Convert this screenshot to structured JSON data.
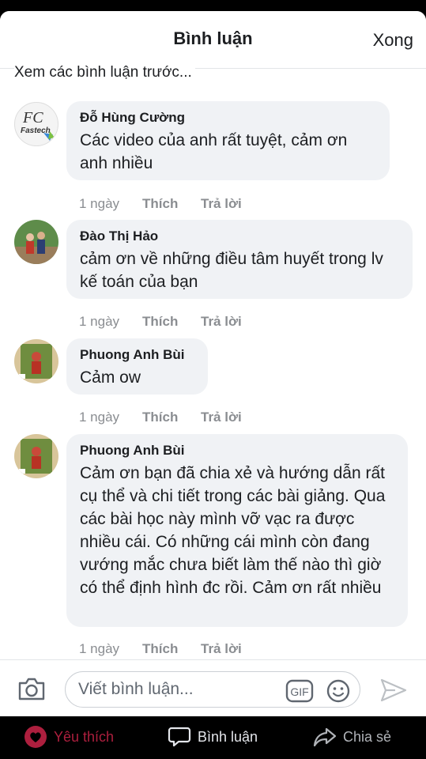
{
  "header": {
    "title": "Bình luận",
    "done_label": "Xong",
    "previous_comments_label": "Xem các bình luận trước..."
  },
  "comments": [
    {
      "author": "Đỗ Hùng Cường",
      "avatar_text": "Fastech",
      "text": "Các video của anh rất tuyệt, cảm ơn anh nhiều",
      "time": "1 ngày",
      "like_label": "Thích",
      "reply_label": "Trả lời"
    },
    {
      "author": "Đào Thị Hảo",
      "text": "cảm ơn về những điều tâm huyết trong lv kế toán của bạn",
      "time": "1 ngày",
      "like_label": "Thích",
      "reply_label": "Trả lời"
    },
    {
      "author": "Phuong Anh Bùi",
      "text": "Cảm ow",
      "time": "1 ngày",
      "like_label": "Thích",
      "reply_label": "Trả lời"
    },
    {
      "author": "Phuong Anh Bùi",
      "text": "Cảm ơn bạn đã chia xẻ và hướng dẫn rất cụ thể và chi tiết trong các bài giảng. Qua các bài học này mình vỡ vạc ra được nhiều cái. Có những cái mình còn đang vướng mắc chưa biết làm thế nào thì giờ có thể định hình đc rồi. Cảm ơn rất nhiều",
      "time": "1 ngày",
      "like_label": "Thích",
      "reply_label": "Trả lời"
    }
  ],
  "composer": {
    "placeholder": "Viết bình luận...",
    "gif_label": "GIF",
    "icons": [
      "camera-icon",
      "gif-icon",
      "smiley-icon",
      "send-icon"
    ]
  },
  "tabbar": {
    "like_label": "Yêu thích",
    "comment_label": "Bình luận",
    "share_label": "Chia sẻ",
    "like_color": "#ad1f3e"
  }
}
